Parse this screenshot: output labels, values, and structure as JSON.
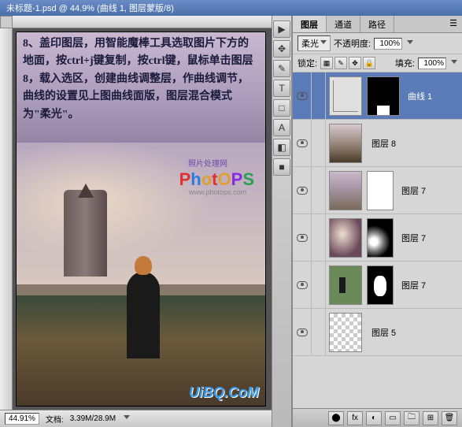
{
  "titlebar": "未标题-1.psd @ 44.9% (曲线 1, 图层蒙版/8)",
  "artwork_text": "8、盖印图层，用智能魔棒工具选取图片下方的地面，按ctrl+j键复制，按ctrl键，鼠标单击图层8，载入选区，创建曲线调整层，作曲线调节，曲线的设置见上图曲线面版，图层混合模式为\"柔光\"。",
  "logo_sub": "照片处理网",
  "logo_url": "www.photops.com",
  "watermark": "UiBQ.CoM",
  "statusbar": {
    "zoom": "44.91%",
    "docsize_label": "文档:",
    "docsize": "3.39M/28.9M"
  },
  "tools": [
    "▶",
    "✥",
    "✎",
    "T",
    "□",
    "A",
    "◧",
    "■"
  ],
  "panel": {
    "tabs": {
      "t1": "图层",
      "t2": "通道",
      "t3": "路径"
    },
    "blend_mode": "柔光",
    "opacity_label": "不透明度:",
    "opacity_value": "100%",
    "lock_label": "锁定:",
    "fill_label": "填充:",
    "fill_value": "100%"
  },
  "layers": [
    {
      "name": "曲线 1",
      "visible": true,
      "selected": true,
      "type": "adjustment"
    },
    {
      "name": "图层 8",
      "visible": true,
      "type": "image",
      "thumb": "img-thumb1"
    },
    {
      "name": "图层 7",
      "visible": true,
      "type": "image",
      "thumb": "img-thumb2",
      "mask": "white"
    },
    {
      "name": "图层 7",
      "visible": true,
      "type": "image",
      "thumb": "img-thumb3",
      "mask": "mask-b2"
    },
    {
      "name": "图层 7",
      "visible": true,
      "type": "image",
      "thumb": "img-thumb4",
      "mask": "mask-b3"
    },
    {
      "name": "图层 5",
      "visible": true,
      "type": "checker"
    }
  ],
  "footer_icons": [
    "⬤",
    "fx",
    "◐",
    "▭",
    "🗀",
    "⊞",
    "🗑"
  ]
}
